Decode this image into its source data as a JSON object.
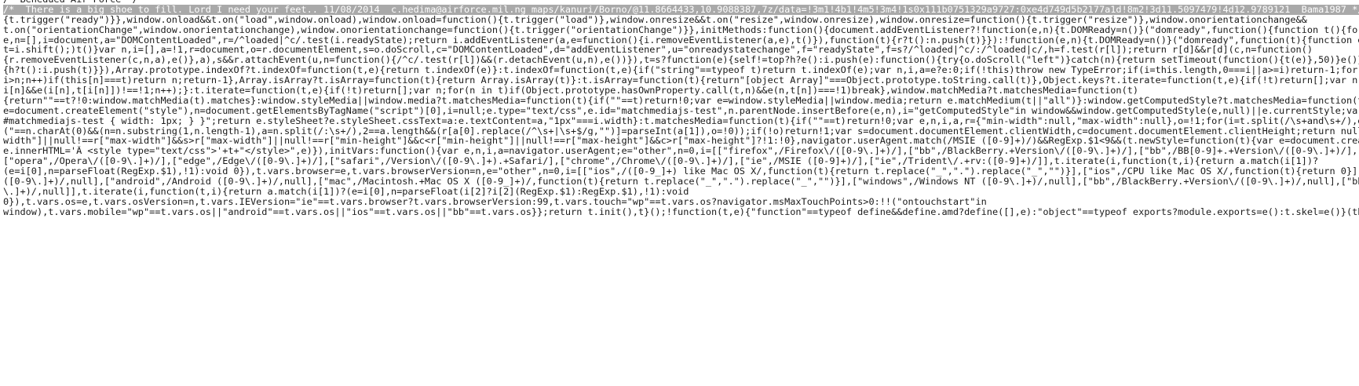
{
  "selection_color": "#a9a9a9",
  "lines": [
    {
      "text": "/* Benedued Air Force */"
    },
    {
      "selected": "/*  There is a big shoe to fill. Lord I need your feet.. 11/08/2014  c.hedima@airforce.mil.ng maps/kanuri/Borno/@11.8664433,10.9088387,7z/data=!3m1!4b1!4m5!3m4!1s0x111b0751329a9727:0xe4d749d5b2177a1d!8m2!3d11.5097479!4d12.9789121  Bama1987 */"
    },
    {
      "text": "{t.trigger(\"ready\")}},window.onload&&t.on(\"load\",window.onload),window.onload=function(){t.trigger(\"load\")},window.onresize&&t.on(\"resize\",window.onresize),window.onresize=function(){t.trigger(\"resize\")},window.onorientationchange&&"
    },
    {
      "text": "t.on(\"orientationChange\",window.onorientationchange),window.onorientationchange=function(){t.trigger(\"orientationChange\")}},initMethods:function(){document.addEventListener?!function(e,n){t.DOMReady=n()}(\"domready\",function(){function t(){for(r=1;"
    },
    {
      "text": "e,n=[],i=document,a=\"DOMContentLoaded\",r=/^loaded|^c/.test(i.readyState);return i.addEventListener(a,e=function(){i.removeEventListener(a,e),t()}),function(t){r?t():n.push(t)}}):!function(e,n){t.DOMReady=n()}(\"domready\",function(t){function e(t){"
    },
    {
      "text": "t=i.shift();)t()}var n,i=[],a=!1,r=document,o=r.documentElement,s=o.doScroll,c=\"DOMContentLoaded\",d=\"addEventListener\",u=\"onreadystatechange\",f=\"readyState\",f=s?/^loaded|^c/:/^loaded|c/,h=f.test(r[l]);return r[d]&&r[d](c,n=function()"
    },
    {
      "text": "{r.removeEventListener(c,n,a),e()},a),s&&r.attachEvent(u,n=function(){/^c/.test(r[l])&&(r.detachEvent(u,n),e())}),t=s?function(e){self!=top?h?e():i.push(e):function(){try{o.doScroll(\"left\")}catch(n){return setTimeout(function(){t(e)},50)}e()}():t"
    },
    {
      "text": "{h?t():i.push(t)}}),Array.prototype.indexOf?t.indexOf=function(t,e){return t.indexOf(e)}:t.indexOf=function(t,e){if(\"string\"==typeof t)return t.indexOf(e);var n,i,a=e?e:0;if(!this)throw new TypeError;if(i=this.length,0===i||a>=i)return-1;for(0>a&&"
    },
    {
      "text": "i>n;n++)if(this[n]===t)return n;return-1},Array.isArray?t.isArray=function(t){return Array.isArray(t)}:t.isArray=function(t){return\"[object Array]\"===Object.prototype.toString.call(t)},Object.keys?t.iterate=function(t,e){if(!t)return[];var n,i=Obj"
    },
    {
      "text": "i[n]&&e(i[n],t[i[n]])!==!1;n++);}:t.iterate=function(t,e){if(!t)return[];var n;for(n in t)if(Object.prototype.hasOwnProperty.call(t,n)&&e(n,t[n])===!1)break},window.matchMedia?t.matchesMedia=function(t)"
    },
    {
      "text": "{return\"\"==t?!0:window.matchMedia(t).matches}:window.styleMedia||window.media?t.matchesMedia=function(t){if(\"\"==t)return!0;var e=window.styleMedia||window.media;return e.matchMedium(t||\"all\")}:window.getComputedStyle?t.matchesMedia=function(t){if("
    },
    {
      "text": "e=document.createElement(\"style\"),n=document.getElementsByTagName(\"script\")[0],i=null;e.type=\"text/css\",e.id=\"matchmediajs-test\",n.parentNode.insertBefore(e,n),i=\"getComputedStyle\"in window&&window.getComputedStyle(e,null)||e.currentStyle;var a=\"@"
    },
    {
      "text": "#matchmediajs-test { width: 1px; } }\";return e.styleSheet?e.styleSheet.cssText=a:e.textContent=a,\"1px\"===i.width}:t.matchesMedia=function(t){if(\"\"==t)return!0;var e,n,i,a,r={\"min-width\":null,\"max-width\":null},o=!1;for(i=t.split(/\\s+and\\s+/),e=0;e<"
    },
    {
      "text": "(\"==n.charAt(0)&&(n=n.substring(1,n.length-1),a=n.split(/:\\s+/),2==a.length&&(r[a[0].replace(/^\\s+|\\s+$/g,\"\")]=parseInt(a[1]),o=!0));if(!o)return!1;var s=document.documentElement.clientWidth,c=document.documentElement.clientHeight;return null!==r["
    },
    {
      "text": "width\"]||null!==r[\"max-width\"]&&s>r[\"max-width\"]||null!==r[\"min-height\"]&&c<r[\"min-height\"]||null!==r[\"max-height\"]&&c>r[\"max-height\"]?!1:!0},navigator.userAgent.match(/MSIE ([0-9]+)/)&&RegExp.$1<9&&(t.newStyle=function(t){var e=document.createEle"
    },
    {
      "text": "e.innerHTML='Â <style type=\"text/css\">'+t+\"</style>\",e)}),initVars:function(){var e,n,i,a=navigator.userAgent;e=\"other\",n=0,i=[[\"firefox\",/Firefox\\/([0-9\\.]+)/],[\"bb\",/BlackBerry.+Version\\/([0-9\\.]+)/],[\"bb\",/BB[0-9]+.+Version\\/([0-9\\.]+)/],[\"opera"
    },
    {
      "text": "[\"opera\",/Opera\\/([0-9\\.]+)/],[\"edge\",/Edge\\/([0-9\\.]+)/],[\"safari\",/Version\\/([0-9\\.]+).+Safari/],[\"chrome\",/Chrome\\/([0-9\\.]+)/],[\"ie\",/MSIE ([0-9]+)/],[\"ie\",/Trident\\/.+rv:([0-9]+)/]],t.iterate(i,function(t,i){return a.match(i[1])?"
    },
    {
      "text": "(e=i[0],n=parseFloat(RegExp.$1),!1):void 0}),t.vars.browser=e,t.vars.browserVersion=n,e=\"other\",n=0,i=[[\"ios\",/([0-9_]+) like Mac OS X/,function(t){return t.replace(\"_\",\".\").replace(\"_\",\"\")}],[\"ios\",/CPU like Mac OS X/,function(t){return 0}],[\"wp\""
    },
    {
      "text": "([0-9\\.]+)/,null],[\"android\",/Android ([0-9\\.]+)/,null],[\"mac\",/Macintosh.+Mac OS X ([0-9_]+)/,function(t){return t.replace(\"_\",\".\").replace(\"_\",\"\")}],[\"windows\",/Windows NT ([0-9\\.]+)/,null],[\"bb\",/BlackBerry.+Version\\/([0-9\\.]+)/,null],[\"bb\",/BB"
    },
    {
      "text": "\\.]+)/,null]],t.iterate(i,function(t,i){return a.match(i[1])?(e=i[0],n=parseFloat(i[2]?i[2](RegExp.$1):RegExp.$1),!1):void"
    },
    {
      "text": "0}),t.vars.os=e,t.vars.osVersion=n,t.vars.IEVersion=\"ie\"==t.vars.browser?t.vars.browserVersion:99,t.vars.touch=\"wp\"==t.vars.os?navigator.msMaxTouchPoints>0:!!(\"ontouchstart\"in"
    },
    {
      "text": "window),t.vars.mobile=\"wp\"==t.vars.os||\"android\"==t.vars.os||\"ios\"==t.vars.os||\"bb\"==t.vars.os}};return t.init(),t}();!function(t,e){\"function\"==typeof define&&define.amd?define([],e):\"object\"==typeof exports?module.exports=e():t.skel=e()}(this,fu"
    }
  ]
}
